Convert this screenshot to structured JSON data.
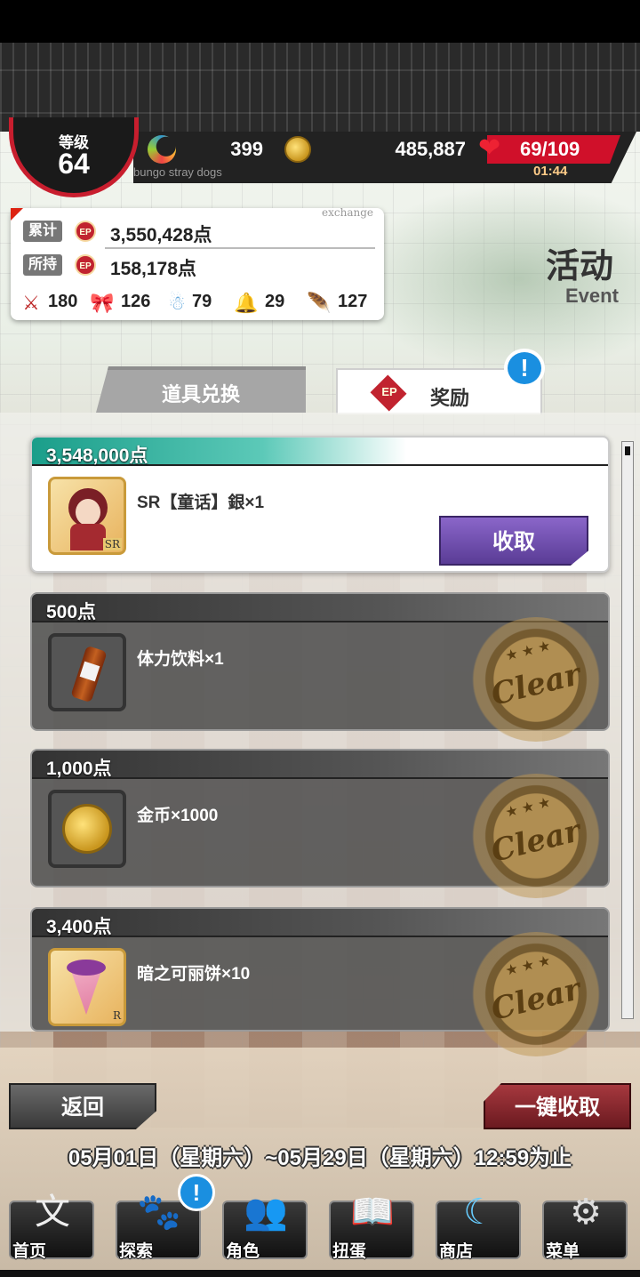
{
  "header": {
    "level_label": "等级",
    "level_value": "64",
    "moon_value": "399",
    "coin_value": "485,887",
    "stamina": "69/109",
    "stamina_timer": "01:44",
    "subtitle": "bungo stray dogs"
  },
  "points_panel": {
    "exchange_label": "exchange",
    "total_label": "累计",
    "total_value": "3,550,428点",
    "held_label": "所持",
    "held_value": "158,178点",
    "ep_label": "EP",
    "materials": [
      {
        "icon": "sword-icon",
        "value": "180"
      },
      {
        "icon": "ribbon-icon",
        "value": "126"
      },
      {
        "icon": "snowman-icon",
        "value": "79"
      },
      {
        "icon": "bell-icon",
        "value": "29"
      },
      {
        "icon": "feather-icon",
        "value": "127"
      }
    ]
  },
  "title": {
    "cn": "活动",
    "en": "Event"
  },
  "tabs": {
    "exchange": "道具兑换",
    "reward": "奖励",
    "reward_ep": "EP",
    "alert": "!"
  },
  "rewards": [
    {
      "points": "3,548,000点",
      "name": "SR【童话】銀×1",
      "state": "claimable",
      "thumb": "character-card-icon"
    },
    {
      "points": "500点",
      "name": "体力饮料×1",
      "state": "clear",
      "thumb": "energy-drink-icon"
    },
    {
      "points": "1,000点",
      "name": "金币×1000",
      "state": "clear",
      "thumb": "gold-coin-icon"
    },
    {
      "points": "3,400点",
      "name": "暗之可丽饼×10",
      "state": "clear",
      "thumb": "crepe-icon"
    }
  ],
  "seal_text": "Clear",
  "claim_label": "收取",
  "back_label": "返回",
  "claim_all_label": "一键收取",
  "period": "05月01日（星期六）~05月29日（星期六）12:59为止",
  "nav": [
    {
      "label": "首页",
      "icon": "home-icon"
    },
    {
      "label": "探索",
      "icon": "explore-icon"
    },
    {
      "label": "角色",
      "icon": "characters-icon"
    },
    {
      "label": "扭蛋",
      "icon": "gacha-icon"
    },
    {
      "label": "商店",
      "icon": "shop-icon"
    },
    {
      "label": "菜单",
      "icon": "menu-gear-icon"
    }
  ],
  "nav_alert": "!"
}
